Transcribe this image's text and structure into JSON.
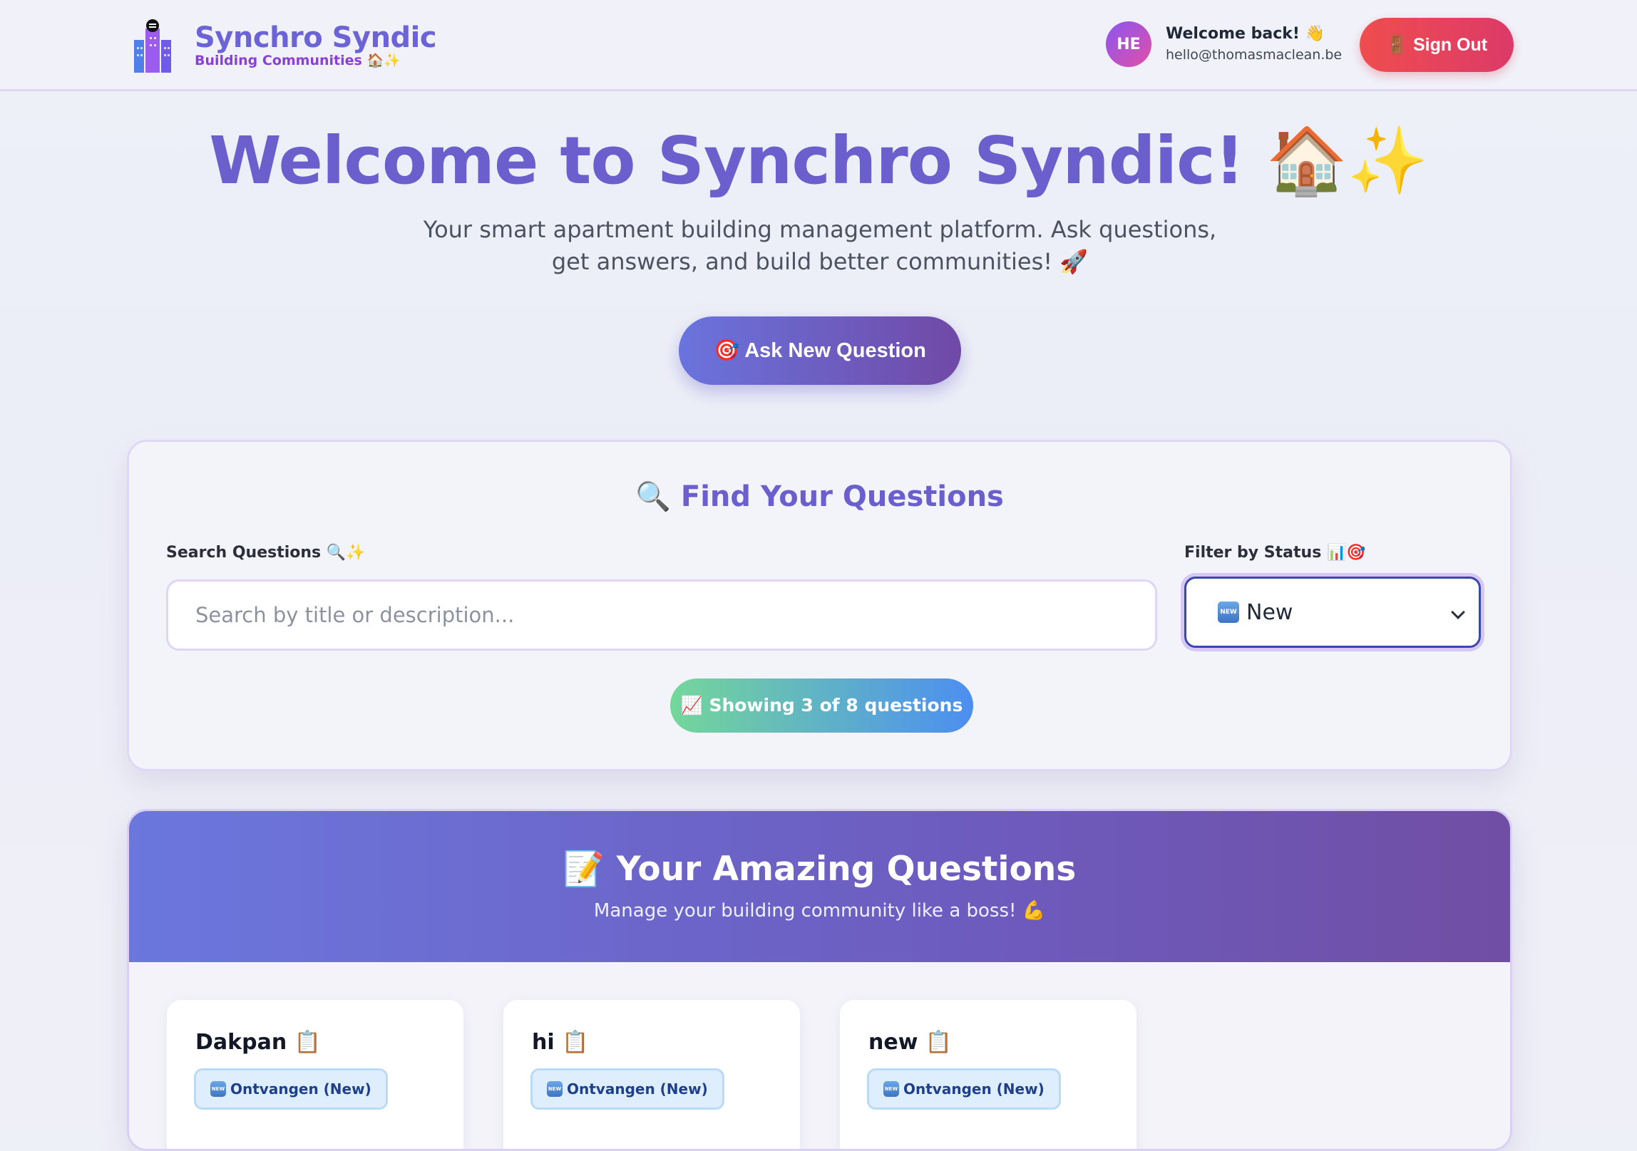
{
  "header": {
    "brand_title": "Synchro Syndic",
    "brand_subtitle": "Building Communities 🏠✨",
    "avatar_initials": "HE",
    "welcome_text": "Welcome back! 👋",
    "user_email": "hello@thomasmaclean.be",
    "signout_label": "🚪 Sign Out"
  },
  "hero": {
    "title": "Welcome to Synchro Syndic! 🏠✨",
    "subtitle": "Your smart apartment building management platform. Ask questions, get answers, and build better communities! 🚀",
    "ask_button_label": "🎯 Ask New Question"
  },
  "search": {
    "heading": "🔍 Find Your Questions",
    "search_label": "Search Questions 🔍✨",
    "search_placeholder": "Search by title or description...",
    "search_value": "",
    "filter_label": "Filter by Status 📊🎯",
    "filter_value": "New",
    "results_text": "📈 Showing 3 of 8 questions"
  },
  "questions": {
    "title": "📝 Your Amazing Questions",
    "subtitle": "Manage your building community like a boss! 💪",
    "items": [
      {
        "title": "Dakpan 📋",
        "status": "Ontvangen (New)"
      },
      {
        "title": "hi 📋",
        "status": "Ontvangen (New)"
      },
      {
        "title": "new 📋",
        "status": "Ontvangen (New)"
      }
    ]
  },
  "colors": {
    "brand": "#6a5fcc",
    "signout": "#e0435d",
    "accent_purple": "#704ea4"
  }
}
